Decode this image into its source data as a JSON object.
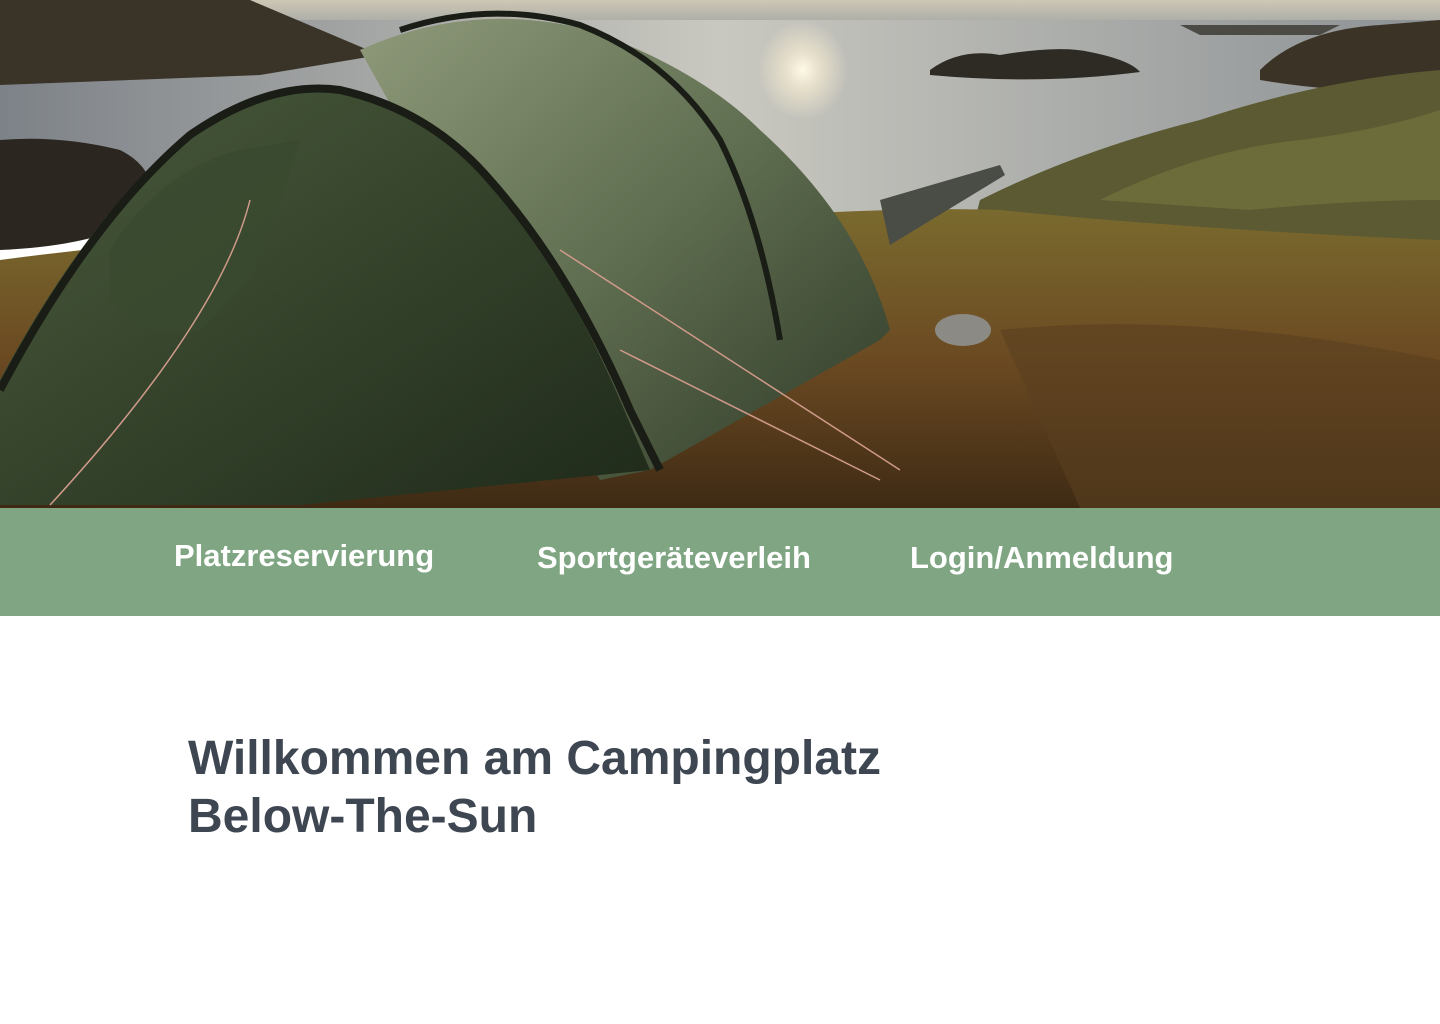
{
  "hero": {
    "image_subject": "camping-tent-by-lake-at-sunset"
  },
  "nav": {
    "background_color": "#7fa582",
    "text_color": "#ffffff",
    "items": [
      {
        "label": "Platzreservierung"
      },
      {
        "label": "Sportgeräteverleih"
      },
      {
        "label": "Login/Anmeldung"
      }
    ]
  },
  "main": {
    "heading_line1": "Willkommen am Campingplatz",
    "heading_line2": "Below-The-Sun",
    "heading_color": "#3d4651"
  }
}
